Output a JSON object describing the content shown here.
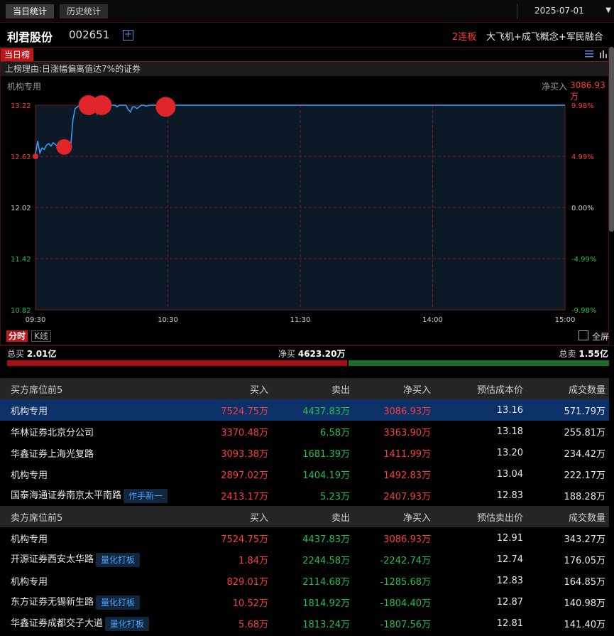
{
  "top_tabs": [
    "当日统计",
    "历史统计"
  ],
  "date": "2025-07-01",
  "stock": {
    "name": "利君股份",
    "code": "002651",
    "board": "2连板",
    "concepts": "大飞机+成飞概念+军民融合"
  },
  "panel": {
    "tag": "当日榜",
    "reason": "上榜理由:日涨幅偏离值达7%的证券",
    "seat": "机构专用",
    "net_label": "净买入",
    "net_value": "3086.93万"
  },
  "chart_data": {
    "type": "line",
    "title": "",
    "y_left_ticks": [
      "13.22",
      "12.62",
      "12.02",
      "11.42",
      "10.82"
    ],
    "y_right_ticks": [
      "9.98%",
      "4.99%",
      "0.00%",
      "-4.99%",
      "-9.98%"
    ],
    "x_ticks": [
      "09:30",
      "10:30",
      "11:30",
      "14:00",
      "15:00"
    ],
    "ylim": [
      10.82,
      13.22
    ],
    "prev_close": 12.02,
    "colors": {
      "line": "#3aa0ff",
      "marker": "#e0262b",
      "grid": "#7a1a1a",
      "area": "#0c1a28",
      "up_text": "#ff3b3b",
      "down_text": "#22c04b"
    },
    "price_series": {
      "x_minutes": [
        0,
        1,
        2,
        3,
        4,
        5,
        6,
        7,
        8,
        9,
        10,
        11,
        12,
        13,
        14,
        15,
        16,
        17,
        18,
        19,
        20,
        21,
        22,
        23,
        24,
        25,
        26,
        27,
        28,
        29,
        30,
        31,
        32,
        33,
        34,
        35,
        36,
        37,
        38,
        39,
        40,
        41,
        42,
        43,
        44,
        45,
        46,
        47,
        48,
        49,
        50,
        52,
        54,
        240
      ],
      "y": [
        12.65,
        12.8,
        12.66,
        12.72,
        12.7,
        12.75,
        12.77,
        12.74,
        12.78,
        12.76,
        12.73,
        12.68,
        12.7,
        12.66,
        12.7,
        12.68,
        12.75,
        13.05,
        13.18,
        13.2,
        13.22,
        13.22,
        13.21,
        13.22,
        13.22,
        13.21,
        13.22,
        13.22,
        13.12,
        13.2,
        13.22,
        13.22,
        13.22,
        13.21,
        13.22,
        13.22,
        13.22,
        13.2,
        13.22,
        13.22,
        13.22,
        13.22,
        13.17,
        13.14,
        13.2,
        13.2,
        13.18,
        13.2,
        13.22,
        13.22,
        13.21,
        13.22,
        13.22,
        13.22
      ]
    },
    "seat_trades": [
      {
        "x_minutes": 0,
        "y": 12.62,
        "size": "small"
      },
      {
        "x_minutes": 13,
        "y": 12.73,
        "size": "medium"
      },
      {
        "x_minutes": 24,
        "y": 13.22,
        "size": "large"
      },
      {
        "x_minutes": 30,
        "y": 13.22,
        "size": "large"
      },
      {
        "x_minutes": 59,
        "y": 13.2,
        "size": "large"
      }
    ]
  },
  "controls": {
    "fenshi": "分时",
    "kline": "K线",
    "fullscreen": "全屏"
  },
  "totals": {
    "buy_label": "总买",
    "buy": "2.01亿",
    "net_label": "净买",
    "net": "4623.20万",
    "sell_label": "总卖",
    "sell": "1.55亿",
    "buy_ratio": 0.565
  },
  "buy_table": {
    "headers": [
      "买方席位前5",
      "买入",
      "卖出",
      "净买入",
      "预估成本价",
      "成交数量"
    ],
    "rows": [
      {
        "name": "机构专用",
        "badge": "",
        "buy": "7524.75万",
        "sell": "4437.83万",
        "net": "3086.93万",
        "price": "13.16",
        "volume": "571.79万"
      },
      {
        "name": "华林证券北京分公司",
        "badge": "",
        "buy": "3370.48万",
        "sell": "6.58万",
        "net": "3363.90万",
        "price": "13.18",
        "volume": "255.81万"
      },
      {
        "name": "华鑫证券上海光复路",
        "badge": "",
        "buy": "3093.38万",
        "sell": "1681.39万",
        "net": "1411.99万",
        "price": "13.20",
        "volume": "234.42万"
      },
      {
        "name": "机构专用",
        "badge": "",
        "buy": "2897.02万",
        "sell": "1404.19万",
        "net": "1492.83万",
        "price": "13.04",
        "volume": "222.17万"
      },
      {
        "name": "国泰海通证券南京太平南路",
        "badge": "作手新一",
        "buy": "2413.17万",
        "sell": "5.23万",
        "net": "2407.93万",
        "price": "12.83",
        "volume": "188.28万"
      }
    ]
  },
  "sell_table": {
    "headers": [
      "卖方席位前5",
      "买入",
      "卖出",
      "净买入",
      "预估卖出价",
      "成交数量"
    ],
    "rows": [
      {
        "name": "机构专用",
        "badge": "",
        "buy": "7524.75万",
        "sell": "4437.83万",
        "net": "3086.93万",
        "price": "12.91",
        "volume": "343.27万"
      },
      {
        "name": "开源证券西安太华路",
        "badge": "量化打板",
        "buy": "1.84万",
        "sell": "2244.58万",
        "net": "-2242.74万",
        "price": "12.74",
        "volume": "176.05万"
      },
      {
        "name": "机构专用",
        "badge": "",
        "buy": "829.01万",
        "sell": "2114.68万",
        "net": "-1285.68万",
        "price": "12.83",
        "volume": "164.85万"
      },
      {
        "name": "东方证券无锡新生路",
        "badge": "量化打板",
        "buy": "10.52万",
        "sell": "1814.92万",
        "net": "-1804.40万",
        "price": "12.87",
        "volume": "140.98万"
      },
      {
        "name": "华鑫证券成都交子大道",
        "badge": "量化打板",
        "buy": "5.68万",
        "sell": "1813.24万",
        "net": "-1807.56万",
        "price": "12.81",
        "volume": "141.40万"
      }
    ]
  }
}
